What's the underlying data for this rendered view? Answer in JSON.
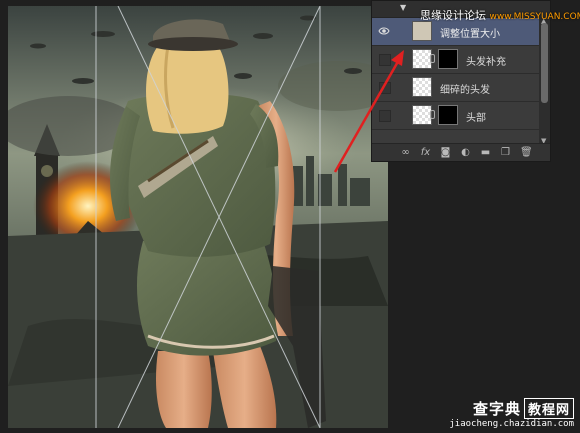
{
  "layers_panel": {
    "layers": [
      {
        "name": "调整位置大小",
        "visible": true,
        "selected": true,
        "has_mask": false
      },
      {
        "name": "头发补充",
        "visible": false,
        "selected": false,
        "has_mask": true
      },
      {
        "name": "细碎的头发",
        "visible": false,
        "selected": false,
        "has_mask": false
      },
      {
        "name": "头部",
        "visible": false,
        "selected": false,
        "has_mask": true
      }
    ],
    "footer_icons": [
      "link-icon",
      "fx-icon",
      "add-mask-icon",
      "adjustment-icon",
      "folder-icon",
      "new-layer-icon",
      "trash-icon"
    ]
  },
  "watermark_top": {
    "title": "思缘设计论坛",
    "site": "www.MISSYUAN.COM"
  },
  "watermark_bottom": {
    "brand": "查字典",
    "box": "教程网",
    "url": "jiaocheng.chazidian.com"
  },
  "colors": {
    "selected_layer": "#4e5a78",
    "annotation_arrow": "#e02020",
    "panel_bg": "#3b3b3b"
  }
}
